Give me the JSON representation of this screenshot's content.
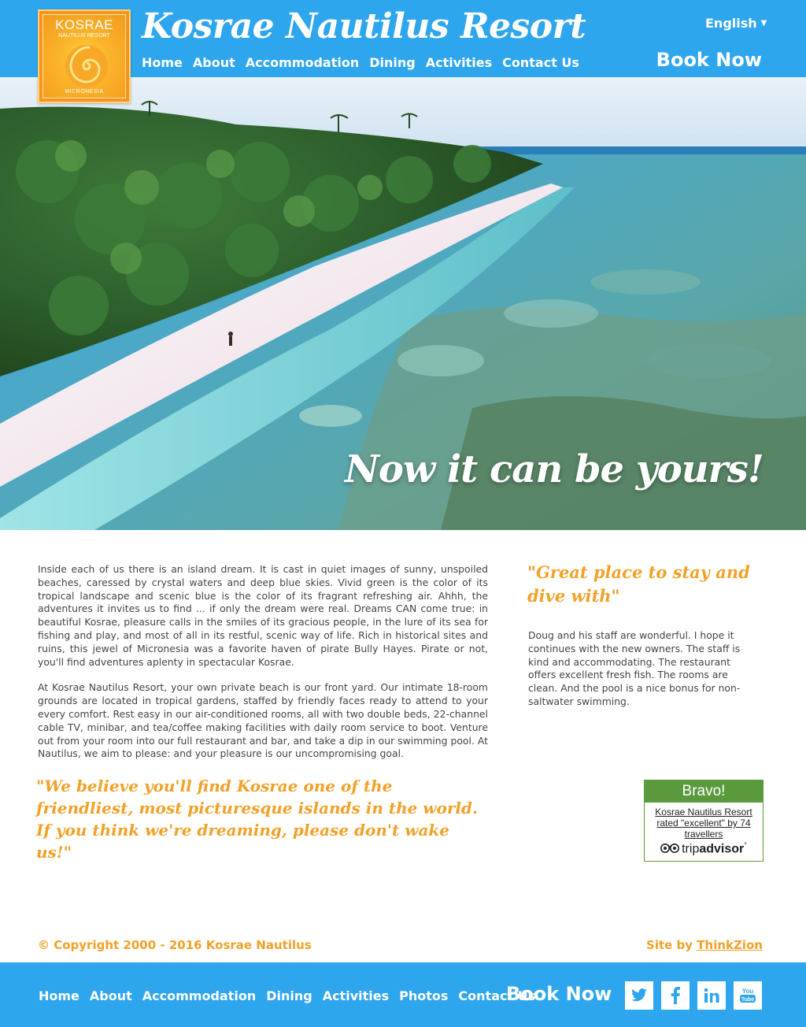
{
  "header": {
    "site_title": "Kosrae Nautilus Resort",
    "logo": {
      "line1": "KOSRAE",
      "line2": "NAUTILUS RESORT",
      "line3": "MICRONESIA"
    },
    "nav": [
      "Home",
      "About",
      "Accommodation",
      "Dining",
      "Activities",
      "Contact Us"
    ],
    "language": "English",
    "book_now": "Book Now"
  },
  "hero": {
    "caption": "Now it can be yours!"
  },
  "main": {
    "paragraphs": [
      "Inside each of us there is an island dream. It is cast in quiet images of sunny, unspoiled beaches, caressed by crystal waters and deep blue skies. Vivid green is the color of its tropical landscape and scenic blue is the color of its fragrant refreshing air. Ahhh, the adventures it invites us to find ... if only the dream were real. Dreams CAN come true: in beautiful Kosrae, pleasure calls in the smiles of its gracious people, in the lure of its sea for fishing and play, and most of all in its restful, scenic way of life. Rich in historical sites and ruins, this jewel of Micronesia was a favorite haven of pirate Bully Hayes. Pirate or not, you'll find adventures aplenty in spectacular Kosrae.",
      "At Kosrae Nautilus Resort, your own private beach is our front yard. Our intimate 18-room grounds are located in tropical gardens, staffed by friendly faces ready to attend to your every comfort. Rest easy in our air-conditioned rooms, all with two double beds, 22-channel cable TV, minibar, and tea/coffee making facilities with daily room service to boot. Venture out from your room into our full restaurant and bar, and take a dip in our swimming pool. At Nautilus, we aim to please: and your pleasure is our uncompromising goal."
    ],
    "quote": "\"We believe you'll find Kosrae one of the friendliest, most picturesque islands in the world. If you think we're dreaming, please don't wake us!\""
  },
  "review": {
    "title": "\"Great place to stay and dive with\"",
    "text": "Doug and his staff are wonderful. I hope it continues with the new owners. The staff is kind and accommodating. The restaurant offers excellent fresh fish. The rooms are clean. And the pool is a nice bonus for non-saltwater swimming."
  },
  "tripadvisor": {
    "heading": "Bravo!",
    "link_text": "Kosrae Nautilus Resort rated \"excellent\" by 74 travellers",
    "brand_prefix": "trip",
    "brand_suffix": "advisor",
    "brand_mark": "°"
  },
  "footer": {
    "copyright": "© Copyright 2000 - 2016 Kosrae Nautilus",
    "site_by_prefix": "Site by",
    "site_by_link": "ThinkZion",
    "nav": [
      "Home",
      "About",
      "Accommodation",
      "Dining",
      "Activities",
      "Photos",
      "Contact Us"
    ],
    "book_now": "Book Now",
    "social": [
      {
        "name": "twitter-icon"
      },
      {
        "name": "facebook-icon"
      },
      {
        "name": "linkedin-icon"
      },
      {
        "name": "youtube-icon"
      }
    ]
  },
  "colors": {
    "brand_blue": "#2ea6ee",
    "accent_orange": "#f2a128",
    "tripadvisor_green": "#5a9a3d"
  }
}
